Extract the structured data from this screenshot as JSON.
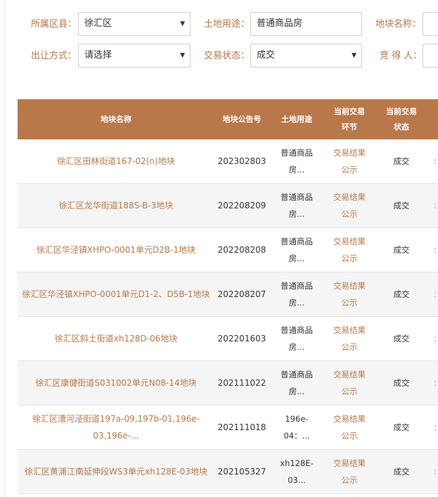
{
  "filters": {
    "district_label": "所属区县：",
    "district_value": "徐汇区",
    "land_use_label": "土地用途：",
    "land_use_value": "普通商品房",
    "plot_name_label": "地块名称：",
    "plot_name_value": "",
    "transfer_method_label": "出让方式：",
    "transfer_method_value": "请选择",
    "trade_status_label": "交易状态：",
    "trade_status_value": "成交",
    "winner_label": "竞 得 人：",
    "winner_value": ""
  },
  "table": {
    "headers": {
      "name": "地块名称",
      "notice_no": "地块公告号",
      "land_use": "土地用途",
      "stage_line1": "当前交易",
      "stage_line2": "环节",
      "state_line1": "当前交易",
      "state_line2": "状态"
    },
    "rows": [
      {
        "name": "徐汇区田林街道167-02(n)地块",
        "notice_no": "202302803",
        "land_use_1": "普通商品",
        "land_use_2": "房...",
        "stage_1": "交易结果",
        "stage_2": "公示",
        "status": "成交"
      },
      {
        "name": "徐汇区龙华街道188S-B-3地块",
        "notice_no": "202208209",
        "land_use_1": "普通商品",
        "land_use_2": "房...",
        "stage_1": "交易结果",
        "stage_2": "公示",
        "status": "成交"
      },
      {
        "name": "徐汇区华泾镇XHPO-0001单元D2B-1地块",
        "notice_no": "202208208",
        "land_use_1": "普通商品",
        "land_use_2": "房...",
        "stage_1": "交易结果",
        "stage_2": "公示",
        "status": "成交"
      },
      {
        "name": "徐汇区华泾镇XHPO-0001单元D1-2、D5B-1地块",
        "notice_no": "202208207",
        "land_use_1": "普通商品",
        "land_use_2": "房...",
        "stage_1": "交易结果",
        "stage_2": "公示",
        "status": "成交"
      },
      {
        "name": "徐汇区斜土街道xh128D-06地块",
        "notice_no": "202201603",
        "land_use_1": "普通商品",
        "land_use_2": "房...",
        "stage_1": "交易结果",
        "stage_2": "公示",
        "status": "成交"
      },
      {
        "name": "徐汇区康健街道S031002单元N08-14地块",
        "notice_no": "202111022",
        "land_use_1": "普通商品",
        "land_use_2": "房...",
        "stage_1": "交易结果",
        "stage_2": "公示",
        "status": "成交"
      },
      {
        "name": "徐汇区漕河泾街道197a-09,197b-01,196e-03,196e-...",
        "notice_no": "202111018",
        "land_use_1": "196e-",
        "land_use_2": "04：...",
        "stage_1": "交易结果",
        "stage_2": "公示",
        "status": "成交"
      },
      {
        "name": "徐汇区黄浦江南延伸段WS3单元xh128E-03地块",
        "notice_no": "202105327",
        "land_use_1": "xh128E-",
        "land_use_2": "03...",
        "stage_1": "交易结果",
        "stage_2": "公示",
        "status": "成交"
      }
    ]
  }
}
